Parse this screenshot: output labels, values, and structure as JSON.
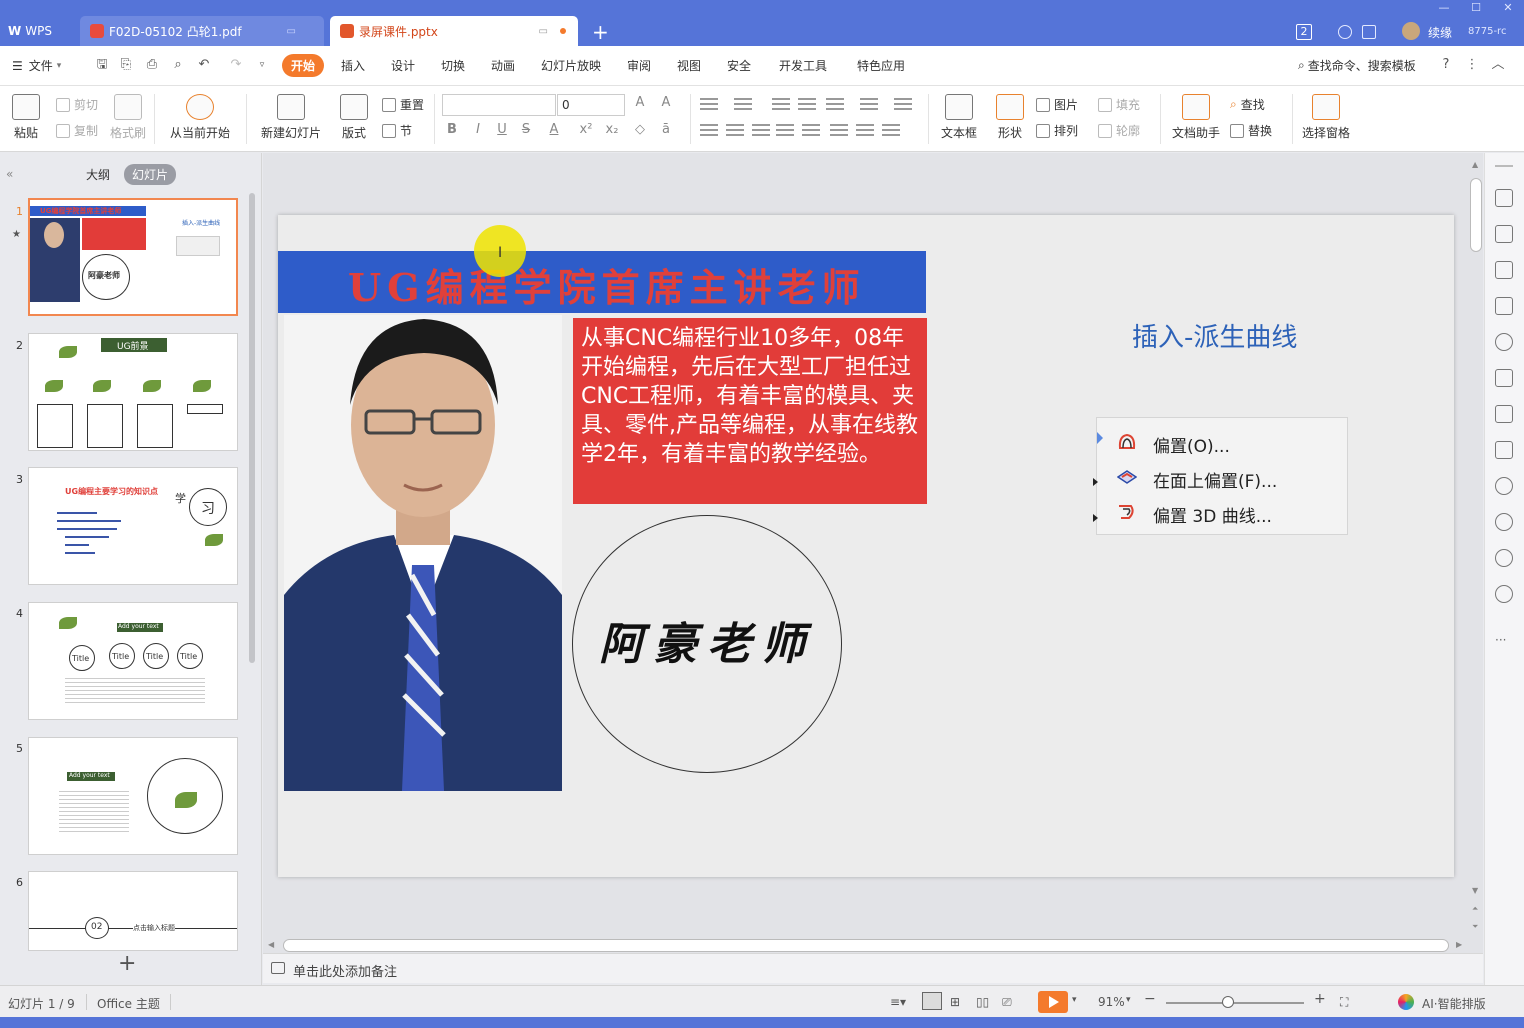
{
  "titlebar": {
    "wps_label": "WPS",
    "tab1": "F02D-05102 凸轮1.pdf",
    "tab2": "录屏课件.pptx",
    "badge": "2",
    "user": "续缘",
    "user_id": "8775-rc"
  },
  "menubar": {
    "file": "文件",
    "items": [
      "开始",
      "插入",
      "设计",
      "切换",
      "动画",
      "幻灯片放映",
      "审阅",
      "视图",
      "安全",
      "开发工具",
      "特色应用"
    ],
    "search": "查找命令、搜索模板"
  },
  "ribbon": {
    "paste": "粘贴",
    "cut": "剪切",
    "copy": "复制",
    "format_painter": "格式刷",
    "from_current": "从当前开始",
    "new_slide": "新建幻灯片",
    "layout": "版式",
    "reset": "重置",
    "section": "节",
    "font_size": "0",
    "textbox": "文本框",
    "shape": "形状",
    "picture": "图片",
    "fill": "填充",
    "arrange": "排列",
    "outline": "轮廓",
    "doc_helper": "文档助手",
    "find": "查找",
    "replace": "替换",
    "select_pane": "选择窗格"
  },
  "leftpane": {
    "tab_outline": "大纲",
    "tab_slides": "幻灯片",
    "numbers": [
      "1",
      "2",
      "3",
      "4",
      "5",
      "6"
    ],
    "thumb1_title": "UG编程学院首席主讲老师",
    "thumb1_side": "插入-派生曲线",
    "thumb1_sig": "阿豪老师",
    "thumb2_title": "UG前景",
    "thumb3_title": "UG编程主要学习的知识点",
    "thumb3_char1": "学",
    "thumb3_char2": "习",
    "thumb4_title": "Add your text",
    "thumb4_circle": "Title",
    "thumb5_title": "Add your text",
    "thumb6_num": "02",
    "thumb6_text": "点击输入标题",
    "add": "+"
  },
  "slide": {
    "title": "UG编程学院首席主讲老师",
    "body": "从事CNC编程行业10多年，08年开始编程，先后在大型工厂担任过CNC工程师，有着丰富的模具、夹具、零件,产品等编程，从事在线教学2年，有着丰富的教学经验。",
    "signature": "阿豪老师",
    "subtitle": "插入-派生曲线",
    "menu_items": [
      "偏置(O)...",
      "在面上偏置(F)...",
      "偏置 3D 曲线..."
    ]
  },
  "notes": {
    "placeholder": "单击此处添加备注"
  },
  "status": {
    "slide_count": "幻灯片 1 / 9",
    "theme": "Office 主题",
    "zoom": "91%",
    "ai": "AI·智能排版"
  },
  "colors": {
    "titlebar": "#5574d8",
    "accent": "#f47a2c",
    "banner": "#2e5cc9",
    "title_red": "#e0403a",
    "body_red": "#e23c39",
    "subtitle_blue": "#2d62b8"
  }
}
